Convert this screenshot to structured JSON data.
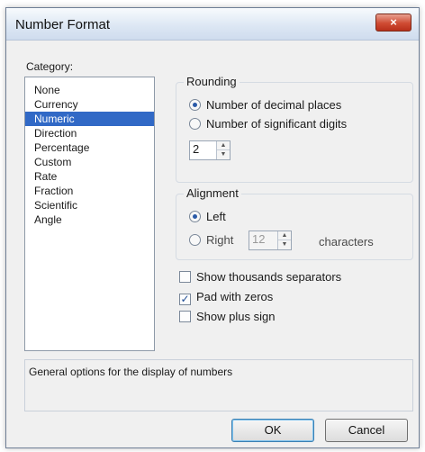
{
  "window": {
    "title": "Number Format",
    "close_label": "×"
  },
  "category": {
    "label": "Category:",
    "items": [
      "None",
      "Currency",
      "Numeric",
      "Direction",
      "Percentage",
      "Custom",
      "Rate",
      "Fraction",
      "Scientific",
      "Angle"
    ],
    "selected": "Numeric"
  },
  "rounding": {
    "title": "Rounding",
    "decimal_places_label": "Number of decimal places",
    "significant_digits_label": "Number of significant digits",
    "selected": "decimal_places",
    "value": "2"
  },
  "alignment": {
    "title": "Alignment",
    "left_label": "Left",
    "right_label": "Right",
    "selected": "left",
    "characters_value": "12",
    "characters_label": "characters"
  },
  "options": {
    "thousands_label": "Show thousands separators",
    "thousands_checked": false,
    "pad_label": "Pad with zeros",
    "pad_checked": true,
    "plus_label": "Show plus sign",
    "plus_checked": false
  },
  "description": "General options for the display of numbers",
  "buttons": {
    "ok": "OK",
    "cancel": "Cancel"
  },
  "icons": {
    "spin_up": "▲",
    "spin_down": "▼",
    "check": "✓"
  }
}
